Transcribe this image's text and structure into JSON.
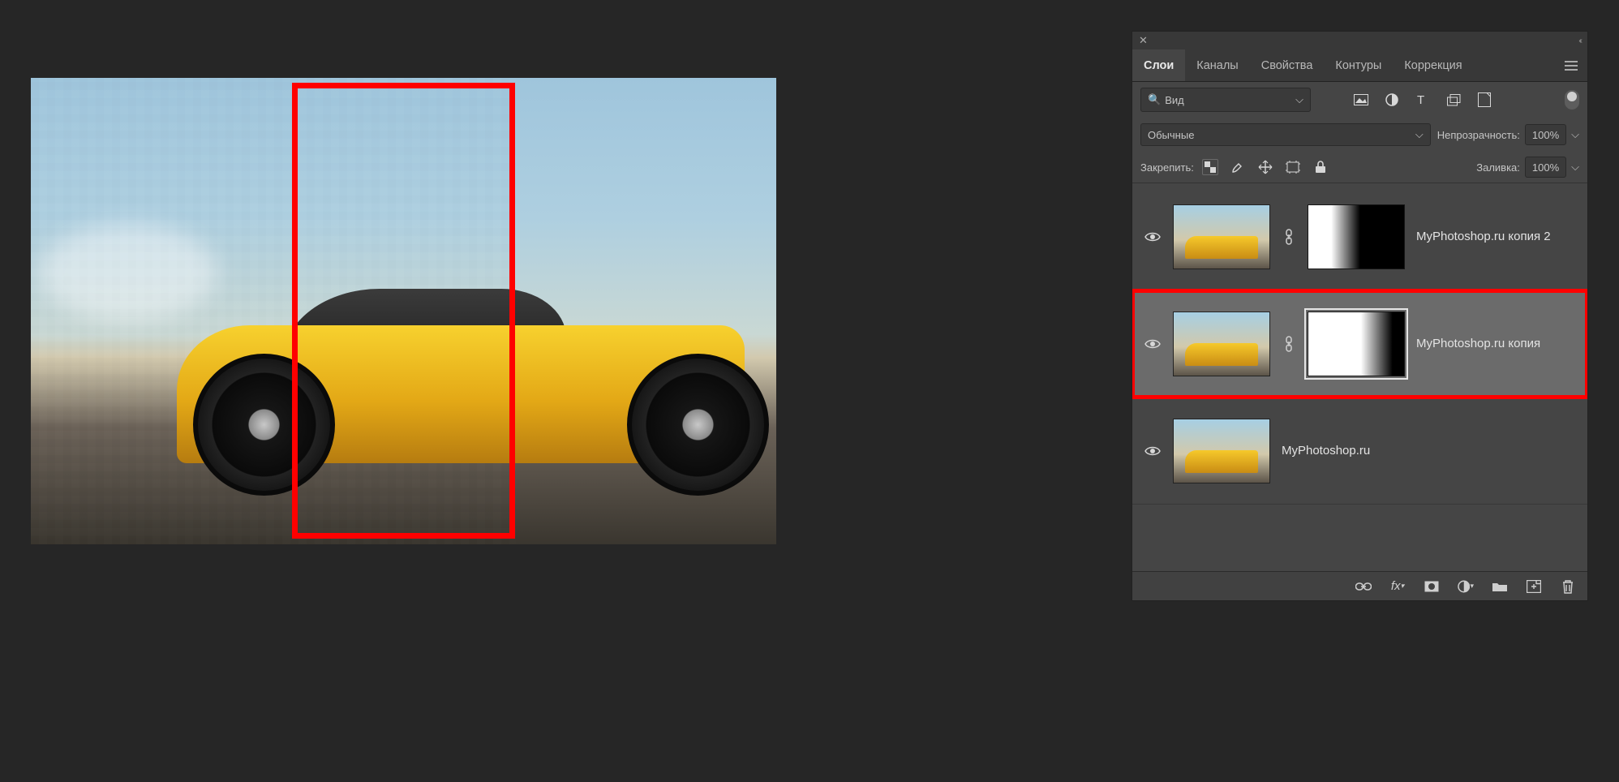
{
  "tabs": {
    "layers": "Слои",
    "channels": "Каналы",
    "properties": "Свойства",
    "paths": "Контуры",
    "adjustments": "Коррекция"
  },
  "search": {
    "label": "Вид"
  },
  "blend": {
    "mode": "Обычные",
    "opacity_label": "Непрозрачность:",
    "opacity_value": "100%"
  },
  "lock": {
    "label": "Закрепить:",
    "fill_label": "Заливка:",
    "fill_value": "100%"
  },
  "layers": [
    {
      "name": "MyPhotoshop.ru копия 2",
      "mask": "grad1",
      "selected": false
    },
    {
      "name": "MyPhotoshop.ru копия",
      "mask": "grad2",
      "selected": true
    },
    {
      "name": "MyPhotoshop.ru",
      "mask": null,
      "selected": false
    }
  ],
  "footer_icons": [
    "link",
    "fx",
    "mask",
    "adjust",
    "group",
    "new",
    "trash"
  ]
}
